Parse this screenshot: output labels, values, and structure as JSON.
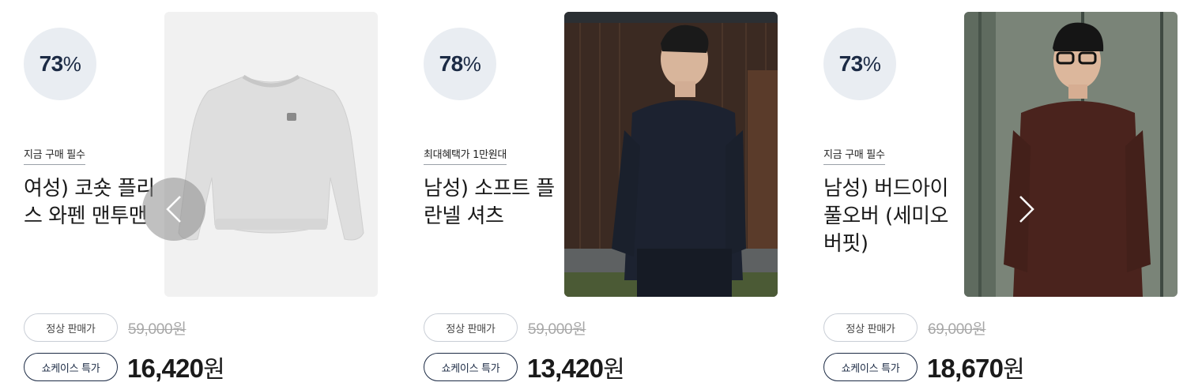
{
  "products": [
    {
      "discount": "73",
      "percent_sign": "%",
      "tag": "지금 구매 필수",
      "title": "여성) 코숏 플리스 와펜 맨투맨",
      "regular_label": "정상 판매가",
      "regular_price": "59,000원",
      "special_label": "쇼케이스 특가",
      "special_price": "16,420",
      "won": "원"
    },
    {
      "discount": "78",
      "percent_sign": "%",
      "tag": "최대혜택가 1만원대",
      "title": "남성) 소프트 플란넬 셔츠",
      "regular_label": "정상 판매가",
      "regular_price": "59,000원",
      "special_label": "쇼케이스 특가",
      "special_price": "13,420",
      "won": "원"
    },
    {
      "discount": "73",
      "percent_sign": "%",
      "tag": "지금 구매 필수",
      "title": "남성) 버드아이 풀오버 (세미오버핏)",
      "regular_label": "정상 판매가",
      "regular_price": "69,000원",
      "special_label": "쇼케이스 특가",
      "special_price": "18,670",
      "won": "원"
    }
  ],
  "nav": {
    "prev_icon": "chevron-left-icon",
    "next_icon": "chevron-right-icon"
  },
  "colors": {
    "navy": "#1c2b45",
    "badge_bg": "#e9edf2",
    "strike": "#a8a8a8"
  }
}
